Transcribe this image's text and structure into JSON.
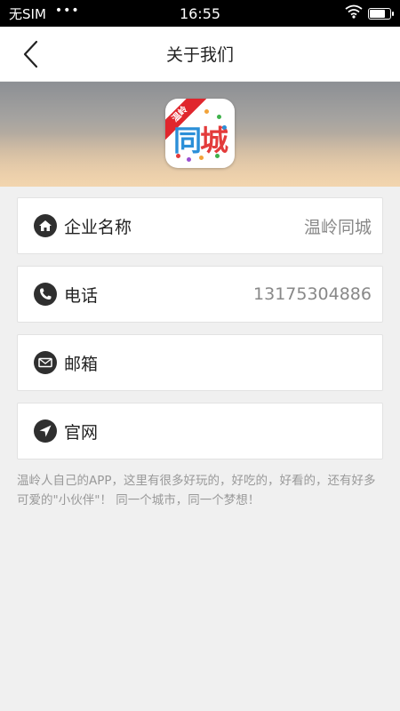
{
  "status_bar": {
    "carrier": "无SIM",
    "dots": "•••",
    "time": "16:55",
    "wifi_icon": "wifi-icon",
    "battery_icon": "battery-icon",
    "battery_level": 0.8
  },
  "nav": {
    "title": "关于我们",
    "back_icon": "chevron-left-icon"
  },
  "banner": {
    "logo": {
      "ribbon": "温岭",
      "text_part1": "同",
      "text_part2": "城"
    }
  },
  "items": [
    {
      "icon": "home-icon",
      "label": "企业名称",
      "value": "温岭同城"
    },
    {
      "icon": "phone-icon",
      "label": "电话",
      "value": "13175304886"
    },
    {
      "icon": "mail-icon",
      "label": "邮箱",
      "value": ""
    },
    {
      "icon": "navigation-icon",
      "label": "官网",
      "value": ""
    }
  ],
  "description": "温岭人自己的APP，这里有很多好玩的，好吃的，好看的，还有好多可爱的\"小伙伴\"！ 同一个城市，同一个梦想！",
  "colors": {
    "icon_bg": "#2f2f2f",
    "logo_red": "#e0262d",
    "logo_blue": "#2b8fd8"
  }
}
